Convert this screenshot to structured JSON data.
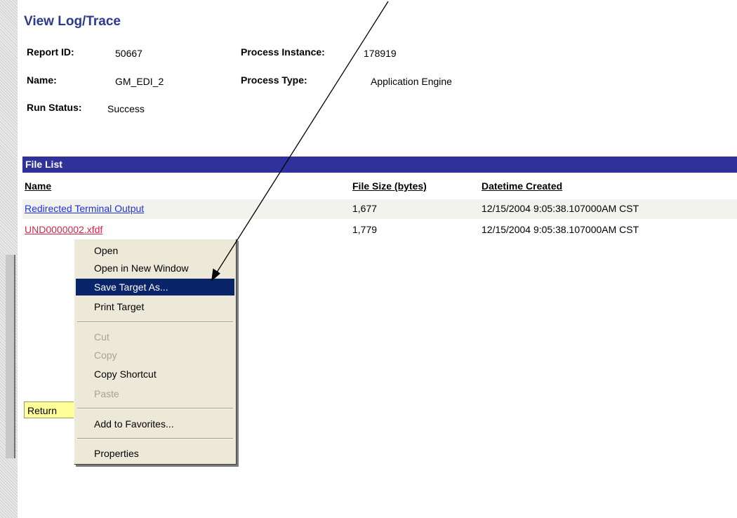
{
  "page": {
    "title": "View Log/Trace"
  },
  "details": {
    "report_id_label": "Report ID:",
    "report_id_value": "50667",
    "process_instance_label": "Process Instance:",
    "process_instance_value": "178919",
    "name_label": "Name:",
    "name_value": "GM_EDI_2",
    "process_type_label": "Process Type:",
    "process_type_value": "Application Engine",
    "run_status_label": "Run Status:",
    "run_status_value": "Success"
  },
  "file_list": {
    "title": "File List",
    "columns": [
      "Name",
      "File Size (bytes)",
      "Datetime Created"
    ],
    "rows": [
      {
        "name": "Redirected Terminal Output",
        "size": "1,677",
        "created": "12/15/2004  9:05:38.107000AM CST"
      },
      {
        "name": "UND0000002.xfdf",
        "size": "1,779",
        "created": "12/15/2004  9:05:38.107000AM CST"
      }
    ]
  },
  "return_button": {
    "label": "Return"
  },
  "context_menu": {
    "items": {
      "open": "Open",
      "open_new_window": "Open in New Window",
      "save_target_as": "Save Target As...",
      "print_target": "Print Target",
      "cut": "Cut",
      "copy": "Copy",
      "copy_shortcut": "Copy Shortcut",
      "paste": "Paste",
      "add_to_favorites": "Add to Favorites...",
      "properties": "Properties"
    },
    "selected": "save_target_as"
  },
  "colors": {
    "header_bar": "#31319c",
    "title_text": "#2b3a8f",
    "link": "#1f31e6",
    "visited_link": "#d6244d",
    "menu_highlight": "#0a246a",
    "button_bg": "#ffff99"
  }
}
